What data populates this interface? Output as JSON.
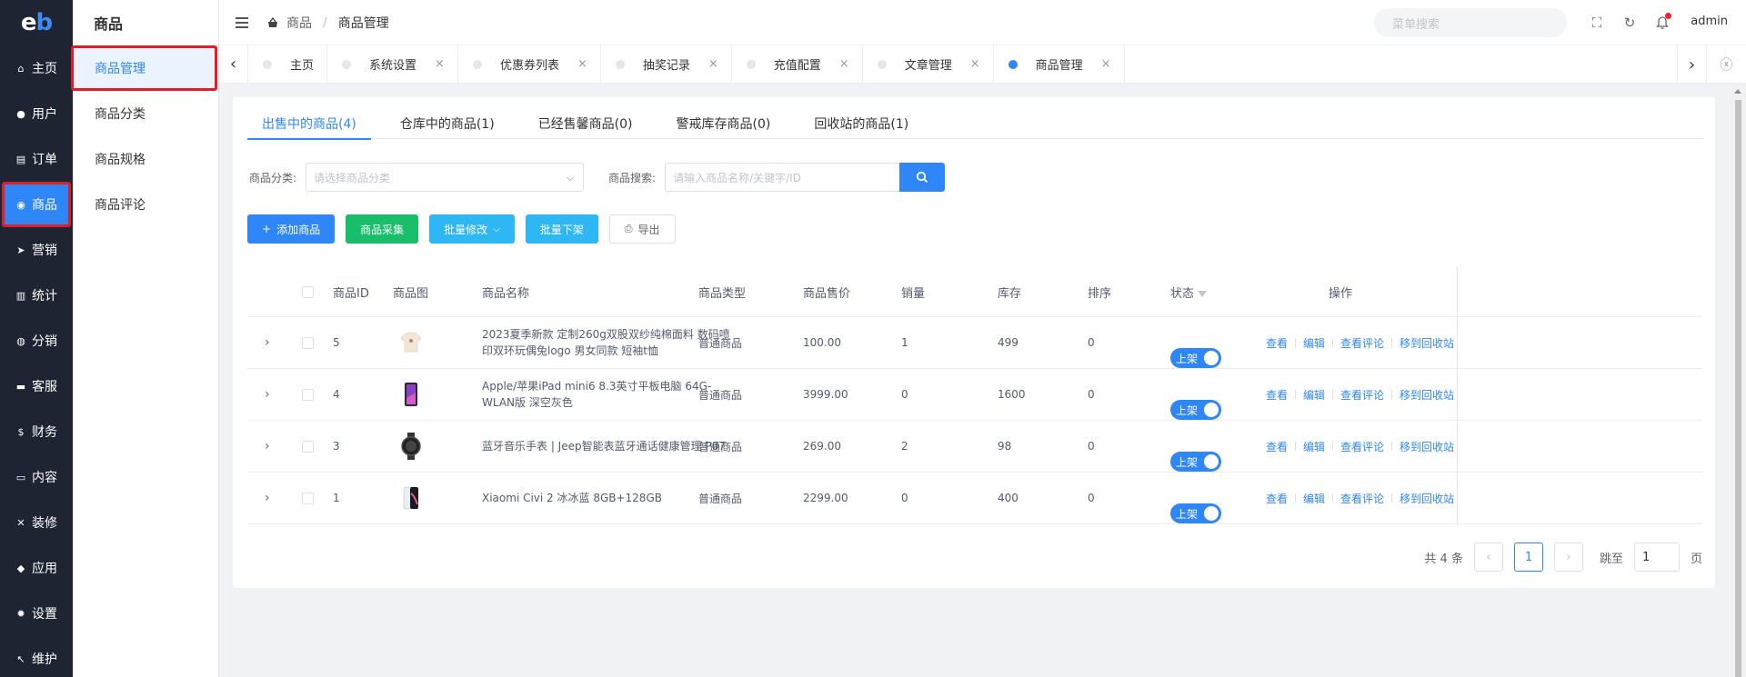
{
  "logo": {
    "text1": "e",
    "text2": "b"
  },
  "nav": [
    {
      "label": "主页",
      "icon": "home-icon",
      "glyph": "⌂"
    },
    {
      "label": "用户",
      "icon": "user-icon",
      "glyph": "●"
    },
    {
      "label": "订单",
      "icon": "cart-icon",
      "glyph": "▤"
    },
    {
      "label": "商品",
      "icon": "shop-icon",
      "glyph": "◉"
    },
    {
      "label": "营销",
      "icon": "send-icon",
      "glyph": "➤"
    },
    {
      "label": "统计",
      "icon": "chart-icon",
      "glyph": "▥"
    },
    {
      "label": "分销",
      "icon": "group-icon",
      "glyph": "◍"
    },
    {
      "label": "客服",
      "icon": "chat-icon",
      "glyph": "▬"
    },
    {
      "label": "财务",
      "icon": "dollar-icon",
      "glyph": "$"
    },
    {
      "label": "内容",
      "icon": "book-icon",
      "glyph": "▭"
    },
    {
      "label": "装修",
      "icon": "tools-icon",
      "glyph": "✕"
    },
    {
      "label": "应用",
      "icon": "cube-icon",
      "glyph": "◆"
    },
    {
      "label": "设置",
      "icon": "gear-icon",
      "glyph": "✹"
    },
    {
      "label": "维护",
      "icon": "hammer-icon",
      "glyph": "↖"
    }
  ],
  "submenu": {
    "title": "商品",
    "items": [
      "商品管理",
      "商品分类",
      "商品规格",
      "商品评论"
    ]
  },
  "header": {
    "breadcrumb1": "商品",
    "breadcrumb2": "商品管理",
    "search_placeholder": "菜单搜索",
    "user": "admin"
  },
  "tags": [
    {
      "label": "主页",
      "closable": false
    },
    {
      "label": "系统设置",
      "closable": true
    },
    {
      "label": "优惠券列表",
      "closable": true
    },
    {
      "label": "抽奖记录",
      "closable": true
    },
    {
      "label": "充值配置",
      "closable": true
    },
    {
      "label": "文章管理",
      "closable": true
    },
    {
      "label": "商品管理",
      "closable": true,
      "active": true
    }
  ],
  "tabs": [
    "出售中的商品(4)",
    "仓库中的商品(1)",
    "已经售馨商品(0)",
    "警戒库存商品(0)",
    "回收站的商品(1)"
  ],
  "filters": {
    "category_label": "商品分类:",
    "category_placeholder": "请选择商品分类",
    "search_label": "商品搜索:",
    "search_placeholder": "请输入商品名称/关键字/ID"
  },
  "buttons": {
    "add": "添加商品",
    "collect": "商品采集",
    "batch_edit": "批量修改",
    "batch_off": "批量下架",
    "export": "导出"
  },
  "table": {
    "headers": [
      "商品ID",
      "商品图",
      "商品名称",
      "商品类型",
      "商品售价",
      "销量",
      "库存",
      "排序",
      "状态",
      "操作"
    ],
    "rows": [
      {
        "id": "5",
        "name": "2023夏季新款 定制260g双股双纱纯棉面料 数码喷印双环玩偶兔logo 男女同款 短袖t恤",
        "type": "普通商品",
        "price": "100.00",
        "sales": "1",
        "stock": "499",
        "sort": "0",
        "status": "上架",
        "thumb": "tshirt"
      },
      {
        "id": "4",
        "name": "Apple/苹果iPad mini6 8.3英寸平板电脑 64G-WLAN版 深空灰色",
        "type": "普通商品",
        "price": "3999.00",
        "sales": "0",
        "stock": "1600",
        "sort": "0",
        "status": "上架",
        "thumb": "ipad"
      },
      {
        "id": "3",
        "name": "蓝牙音乐手表 | Jeep智能表蓝牙通话健康管理 P07",
        "type": "普通商品",
        "price": "269.00",
        "sales": "2",
        "stock": "98",
        "sort": "0",
        "status": "上架",
        "thumb": "watch"
      },
      {
        "id": "1",
        "name": "Xiaomi Civi 2 冰冰蓝 8GB+128GB",
        "type": "普通商品",
        "price": "2299.00",
        "sales": "0",
        "stock": "400",
        "sort": "0",
        "status": "上架",
        "thumb": "phone"
      }
    ],
    "ops": [
      "查看",
      "编辑",
      "查看评论",
      "移到回收站"
    ]
  },
  "pager": {
    "total": "共 4 条",
    "page": "1",
    "goto": "跳至",
    "goto_value": "1",
    "page_unit": "页"
  },
  "colors": {
    "primary": "#2f86f6",
    "nav_bg": "#1f2433",
    "green": "#19be6b",
    "cyan": "#2db7f5",
    "highlight": "#e51c23"
  }
}
